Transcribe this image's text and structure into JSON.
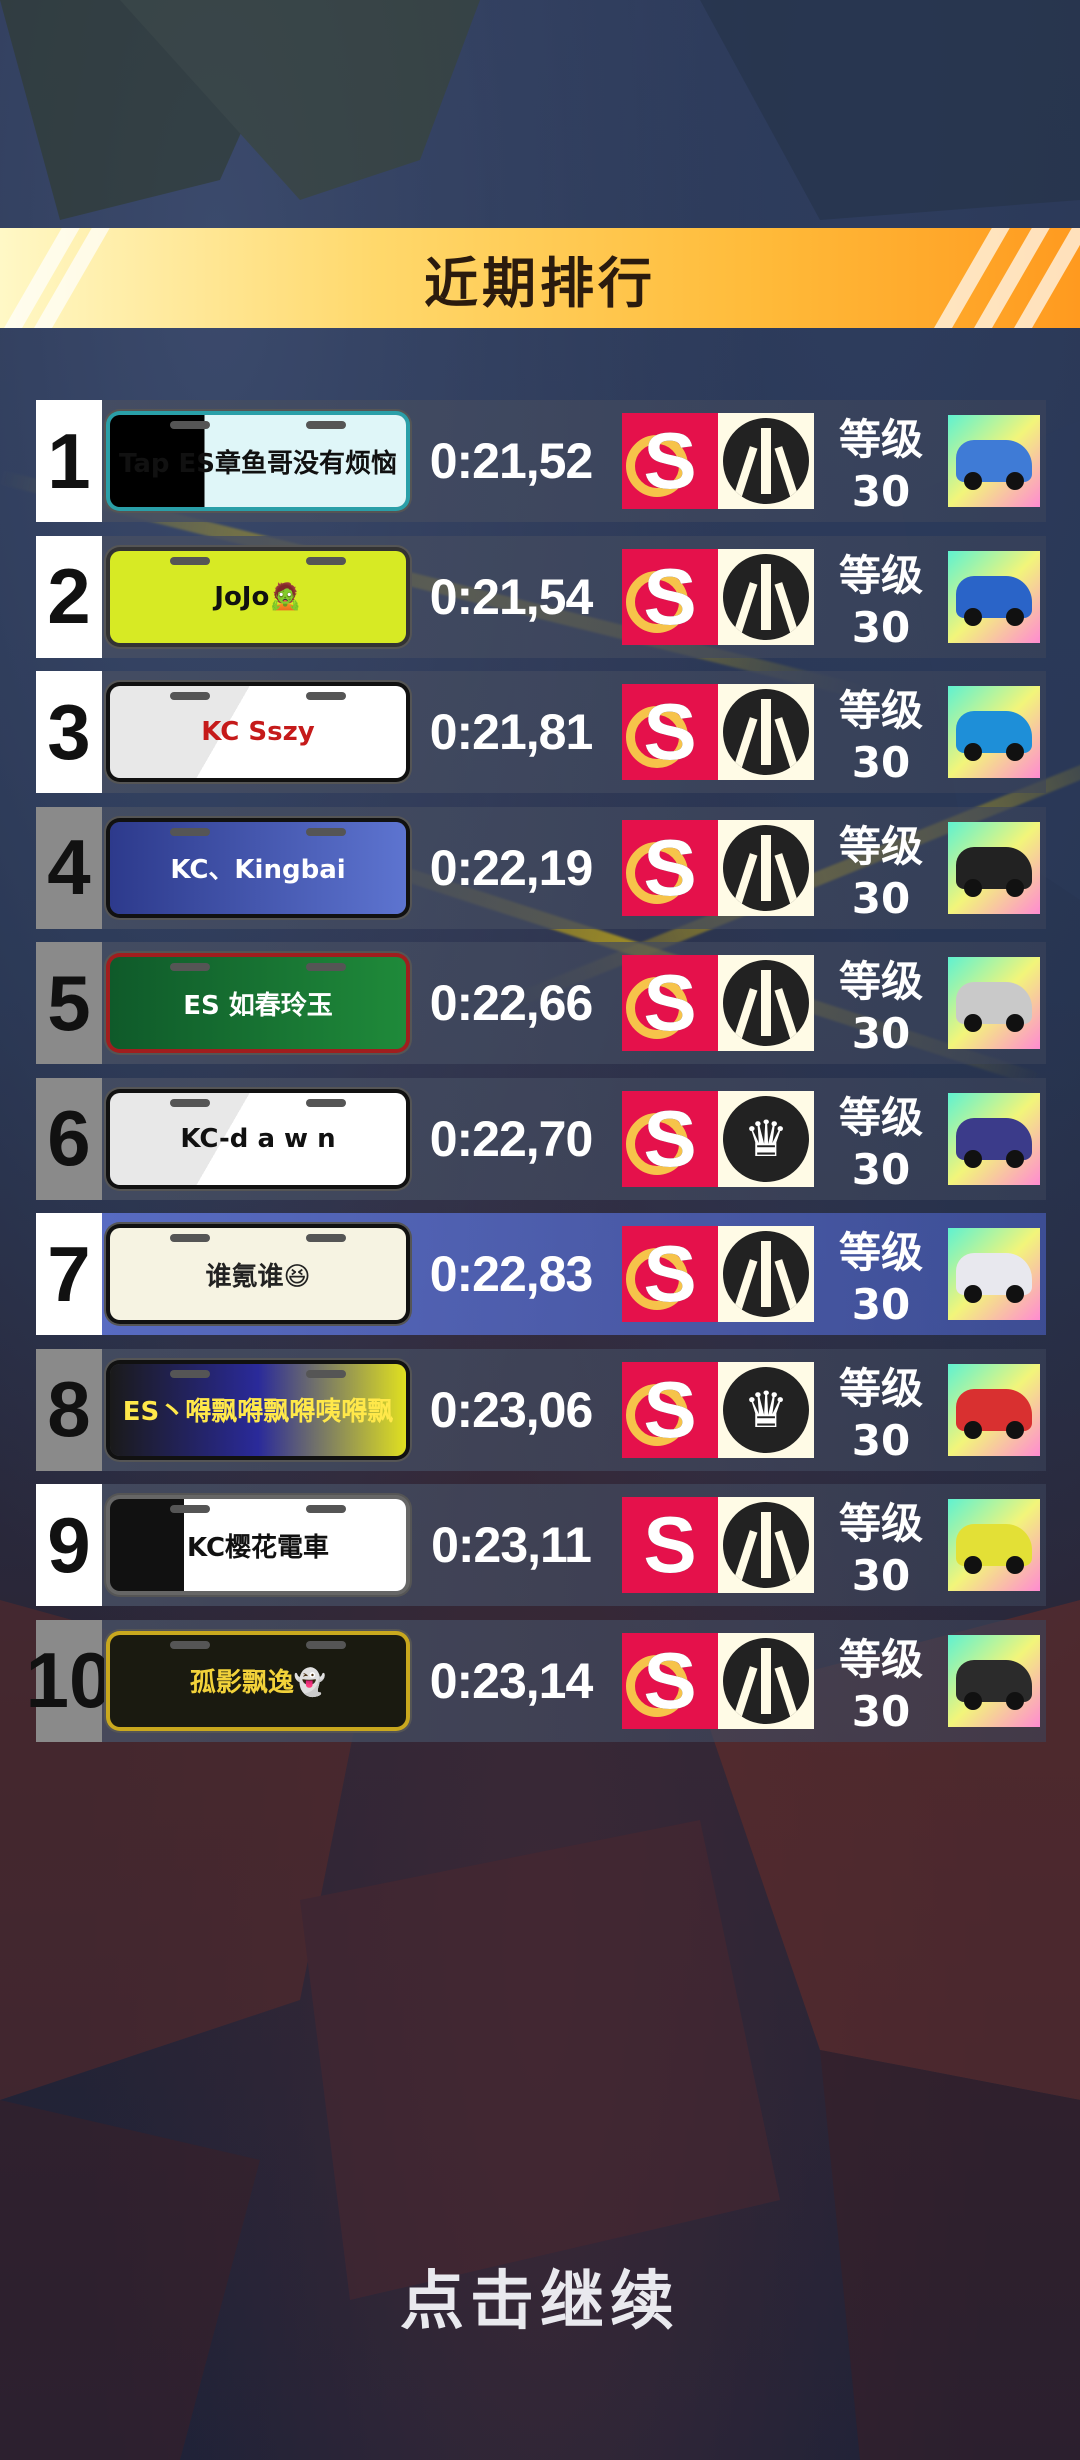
{
  "title": "近期排行",
  "continue_label": "点击继续",
  "rows": [
    {
      "rank": "1",
      "plate": "Tap ES章鱼哥没有烦恼",
      "time": "0:21,52",
      "level": "等级30",
      "badge2": "road-icon",
      "car_color": "#3f7bd6"
    },
    {
      "rank": "2",
      "plate": "JoJo🧟",
      "time": "0:21,54",
      "level": "等级30",
      "badge2": "road-icon",
      "car_color": "#2a64c8"
    },
    {
      "rank": "3",
      "plate": "KC Sszy",
      "time": "0:21,81",
      "level": "等级30",
      "badge2": "road-icon",
      "car_color": "#1e8fd8"
    },
    {
      "rank": "4",
      "plate": "KC、Kingbai",
      "time": "0:22,19",
      "level": "等级30",
      "badge2": "road-icon",
      "car_color": "#222222"
    },
    {
      "rank": "5",
      "plate": "ES 如春玲玉",
      "time": "0:22,66",
      "level": "等级30",
      "badge2": "road-icon",
      "car_color": "#c9c9c9"
    },
    {
      "rank": "6",
      "plate": "KC-d a w n",
      "time": "0:22,70",
      "level": "等级30",
      "badge2": "crown-icon",
      "car_color": "#3b3b8a"
    },
    {
      "rank": "7",
      "plate": "谁氪谁😆",
      "time": "0:22,83",
      "level": "等级30",
      "badge2": "road-icon",
      "car_color": "#e8e8ee"
    },
    {
      "rank": "8",
      "plate": "ES丶嘚飘嘚飘嘚咦嘚飘",
      "time": "0:23,06",
      "level": "等级30",
      "badge2": "crown-icon",
      "car_color": "#d93030"
    },
    {
      "rank": "9",
      "plate": "KC樱花電車",
      "time": "0:23,11",
      "level": "等级30",
      "badge2": "road-icon",
      "car_color": "#e3e036"
    },
    {
      "rank": "10",
      "plate": "孤影飘逸👻",
      "time": "0:23,14",
      "level": "等级30",
      "badge2": "road-icon",
      "car_color": "#2b2b2b"
    }
  ],
  "colors": {
    "accent": "#ffbb3a",
    "badge_red": "#e5114b",
    "highlight": "#5a6ec8"
  }
}
